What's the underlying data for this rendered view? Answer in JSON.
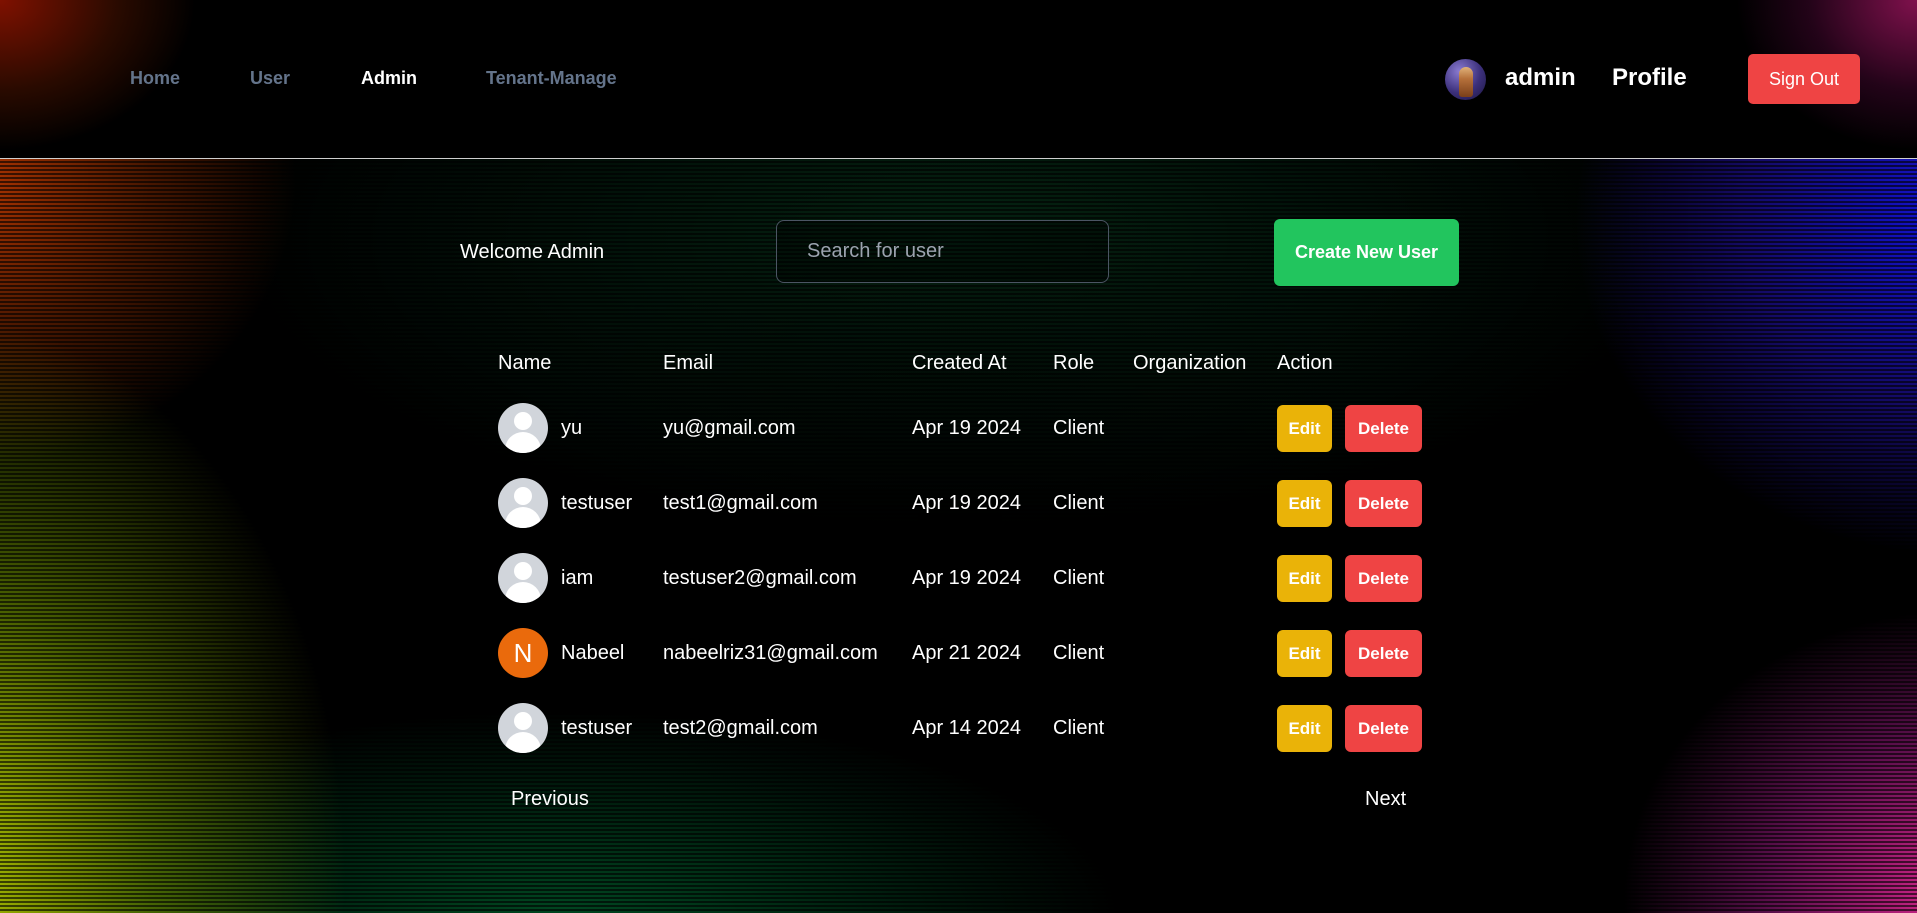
{
  "nav": {
    "items": [
      {
        "label": "Home",
        "active": false
      },
      {
        "label": "User",
        "active": false
      },
      {
        "label": "Admin",
        "active": true
      },
      {
        "label": "Tenant-Manage",
        "active": false
      }
    ],
    "username": "admin",
    "profile_label": "Profile",
    "signout_label": "Sign Out",
    "avatar_icon": "user-photo-avatar"
  },
  "toolbar": {
    "welcome": "Welcome Admin",
    "search_placeholder": "Search for user",
    "search_value": "",
    "create_label": "Create New User"
  },
  "table": {
    "headers": [
      "Name",
      "Email",
      "Created At",
      "Role",
      "Organization",
      "Action"
    ],
    "rows": [
      {
        "avatar": "default",
        "initial": "",
        "name": "yu",
        "email": "yu@gmail.com",
        "created": "Apr 19 2024",
        "role": "Client",
        "organization": "",
        "edit": "Edit",
        "delete": "Delete"
      },
      {
        "avatar": "default",
        "initial": "",
        "name": "testuser",
        "email": "test1@gmail.com",
        "created": "Apr 19 2024",
        "role": "Client",
        "organization": "",
        "edit": "Edit",
        "delete": "Delete"
      },
      {
        "avatar": "default",
        "initial": "",
        "name": "iam",
        "email": "testuser2@gmail.com",
        "created": "Apr 19 2024",
        "role": "Client",
        "organization": "",
        "edit": "Edit",
        "delete": "Delete"
      },
      {
        "avatar": "initial",
        "initial": "N",
        "name": "Nabeel",
        "email": "nabeelriz31@gmail.com",
        "created": "Apr 21 2024",
        "role": "Client",
        "organization": "",
        "edit": "Edit",
        "delete": "Delete"
      },
      {
        "avatar": "default",
        "initial": "",
        "name": "testuser",
        "email": "test2@gmail.com",
        "created": "Apr 14 2024",
        "role": "Client",
        "organization": "",
        "edit": "Edit",
        "delete": "Delete"
      }
    ]
  },
  "pagination": {
    "previous_label": "Previous",
    "next_label": "Next"
  },
  "colors": {
    "danger": "#ef4444",
    "success": "#22c55e",
    "warning": "#eab308",
    "initial_avatar": "#ea6a0c",
    "nav_inactive": "#64748b"
  }
}
